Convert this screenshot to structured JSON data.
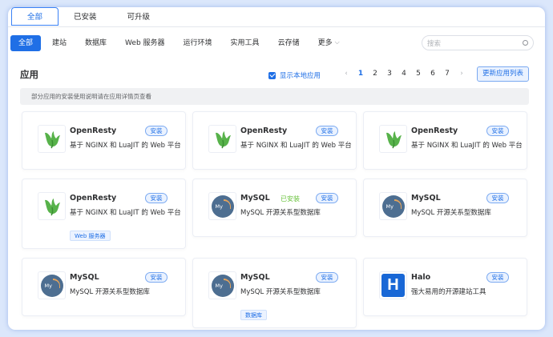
{
  "top_tabs": [
    {
      "label": "全部",
      "active": true
    },
    {
      "label": "已安装",
      "active": false
    },
    {
      "label": "可升级",
      "active": false
    }
  ],
  "categories": [
    {
      "label": "全部",
      "active": true
    },
    {
      "label": "建站"
    },
    {
      "label": "数据库"
    },
    {
      "label": "Web 服务器"
    },
    {
      "label": "运行环境"
    },
    {
      "label": "实用工具"
    },
    {
      "label": "云存储"
    },
    {
      "label": "更多"
    }
  ],
  "search": {
    "placeholder": "搜索"
  },
  "page_title": "应用",
  "show_local": {
    "label": "显示本地应用",
    "checked": true
  },
  "pagination": {
    "pages": [
      "1",
      "2",
      "3",
      "4",
      "5",
      "6",
      "7"
    ],
    "current": "1"
  },
  "refresh_button": "更新应用列表",
  "notice": "部分应用的安装使用说明请在应用详情页查看",
  "apps": [
    {
      "name": "OpenResty",
      "desc": "基于 NGINX 和 LuaJIT 的 Web 平台",
      "button": "安装",
      "icon": "openresty-icon",
      "installed": "",
      "tag": ""
    },
    {
      "name": "OpenResty",
      "desc": "基于 NGINX 和 LuaJIT 的 Web 平台",
      "button": "安装",
      "icon": "openresty-icon",
      "installed": "",
      "tag": ""
    },
    {
      "name": "OpenResty",
      "desc": "基于 NGINX 和 LuaJIT 的 Web 平台",
      "button": "安装",
      "icon": "openresty-icon",
      "installed": "",
      "tag": ""
    },
    {
      "name": "OpenResty",
      "desc": "基于 NGINX 和 LuaJIT 的 Web 平台",
      "button": "安装",
      "icon": "openresty-icon",
      "installed": "",
      "tag": "Web 服务器"
    },
    {
      "name": "MySQL",
      "desc": "MySQL 开源关系型数据库",
      "button": "安装",
      "icon": "mysql-icon",
      "installed": "已安装",
      "tag": ""
    },
    {
      "name": "MySQL",
      "desc": "MySQL 开源关系型数据库",
      "button": "安装",
      "icon": "mysql-icon",
      "installed": "",
      "tag": ""
    },
    {
      "name": "MySQL",
      "desc": "MySQL 开源关系型数据库",
      "button": "安装",
      "icon": "mysql-icon",
      "installed": "",
      "tag": ""
    },
    {
      "name": "MySQL",
      "desc": "MySQL 开源关系型数据库",
      "button": "安装",
      "icon": "mysql-icon",
      "installed": "",
      "tag": "数据库"
    },
    {
      "name": "Halo",
      "desc": "强大易用的开源建站工具",
      "button": "安装",
      "icon": "halo-icon",
      "installed": "",
      "tag": ""
    }
  ],
  "colors": {
    "accent": "#1f6fe6",
    "installed": "#67c23a",
    "background": "#dbe7fb"
  }
}
